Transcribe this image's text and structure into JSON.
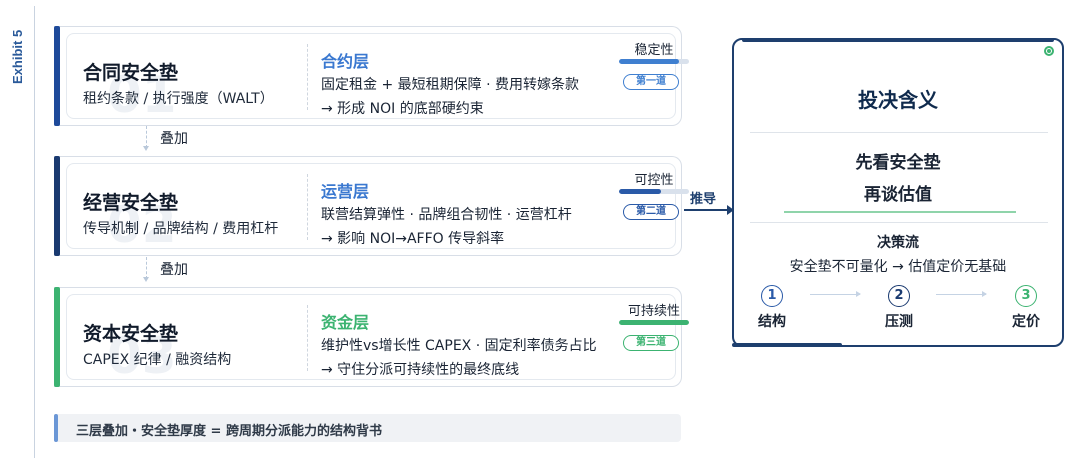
{
  "exhibit_label": "Exhibit 5",
  "layers": [
    {
      "title": "合同安全垫",
      "subtitle": "租约条款 / 执行强度（WALT）",
      "watermark": "01",
      "layer_name": "合约层",
      "line1": "固定租金 + 最短租期保障 · 费用转嫁条款",
      "line2": "→ 形成 NOI 的底部硬约束",
      "metric_label": "稳定性",
      "metric_level": 0.85,
      "badge": "第一道",
      "accent": "#1e4a9a",
      "accent_soft": "#3f7fd0",
      "name_color": "#3a78d0"
    },
    {
      "title": "经营安全垫",
      "subtitle": "传导机制 / 品牌结构 / 费用杠杆",
      "watermark": "02",
      "layer_name": "运营层",
      "line1": "联营结算弹性 · 品牌组合韧性 · 运营杠杆",
      "line2": "→ 影响 NOI→AFFO 传导斜率",
      "metric_label": "可控性",
      "metric_level": 0.6,
      "badge": "第二道",
      "accent": "#1a3a70",
      "accent_soft": "#2a5aa8",
      "name_color": "#3a78d0"
    },
    {
      "title": "资本安全垫",
      "subtitle": "CAPEX 纪律 / 融资结构",
      "watermark": "03",
      "layer_name": "资金层",
      "line1": "维护性vs增长性 CAPEX · 固定利率债务占比",
      "line2": "→ 守住分派可持续性的最终底线",
      "metric_label": "可持续性",
      "metric_level": 1.0,
      "badge": "第三道",
      "accent": "#3cb371",
      "accent_soft": "#3cb371",
      "name_color": "#3cb371"
    }
  ],
  "stack_label": "叠加",
  "push_label": "推导",
  "summary": "三层叠加・安全垫厚度 = 跨周期分派能力的结构背书",
  "panel": {
    "title": "投决含义",
    "message_line1": "先看安全垫",
    "message_line2": "再谈估值",
    "flow_title": "决策流",
    "flow_sub": "安全垫不可量化 → 估值定价无基础",
    "steps": [
      {
        "num": "1",
        "label": "结构",
        "color": "#2a5aa8"
      },
      {
        "num": "2",
        "label": "压测",
        "color": "#1a3a70"
      },
      {
        "num": "3",
        "label": "定价",
        "color": "#3cb371"
      }
    ]
  }
}
